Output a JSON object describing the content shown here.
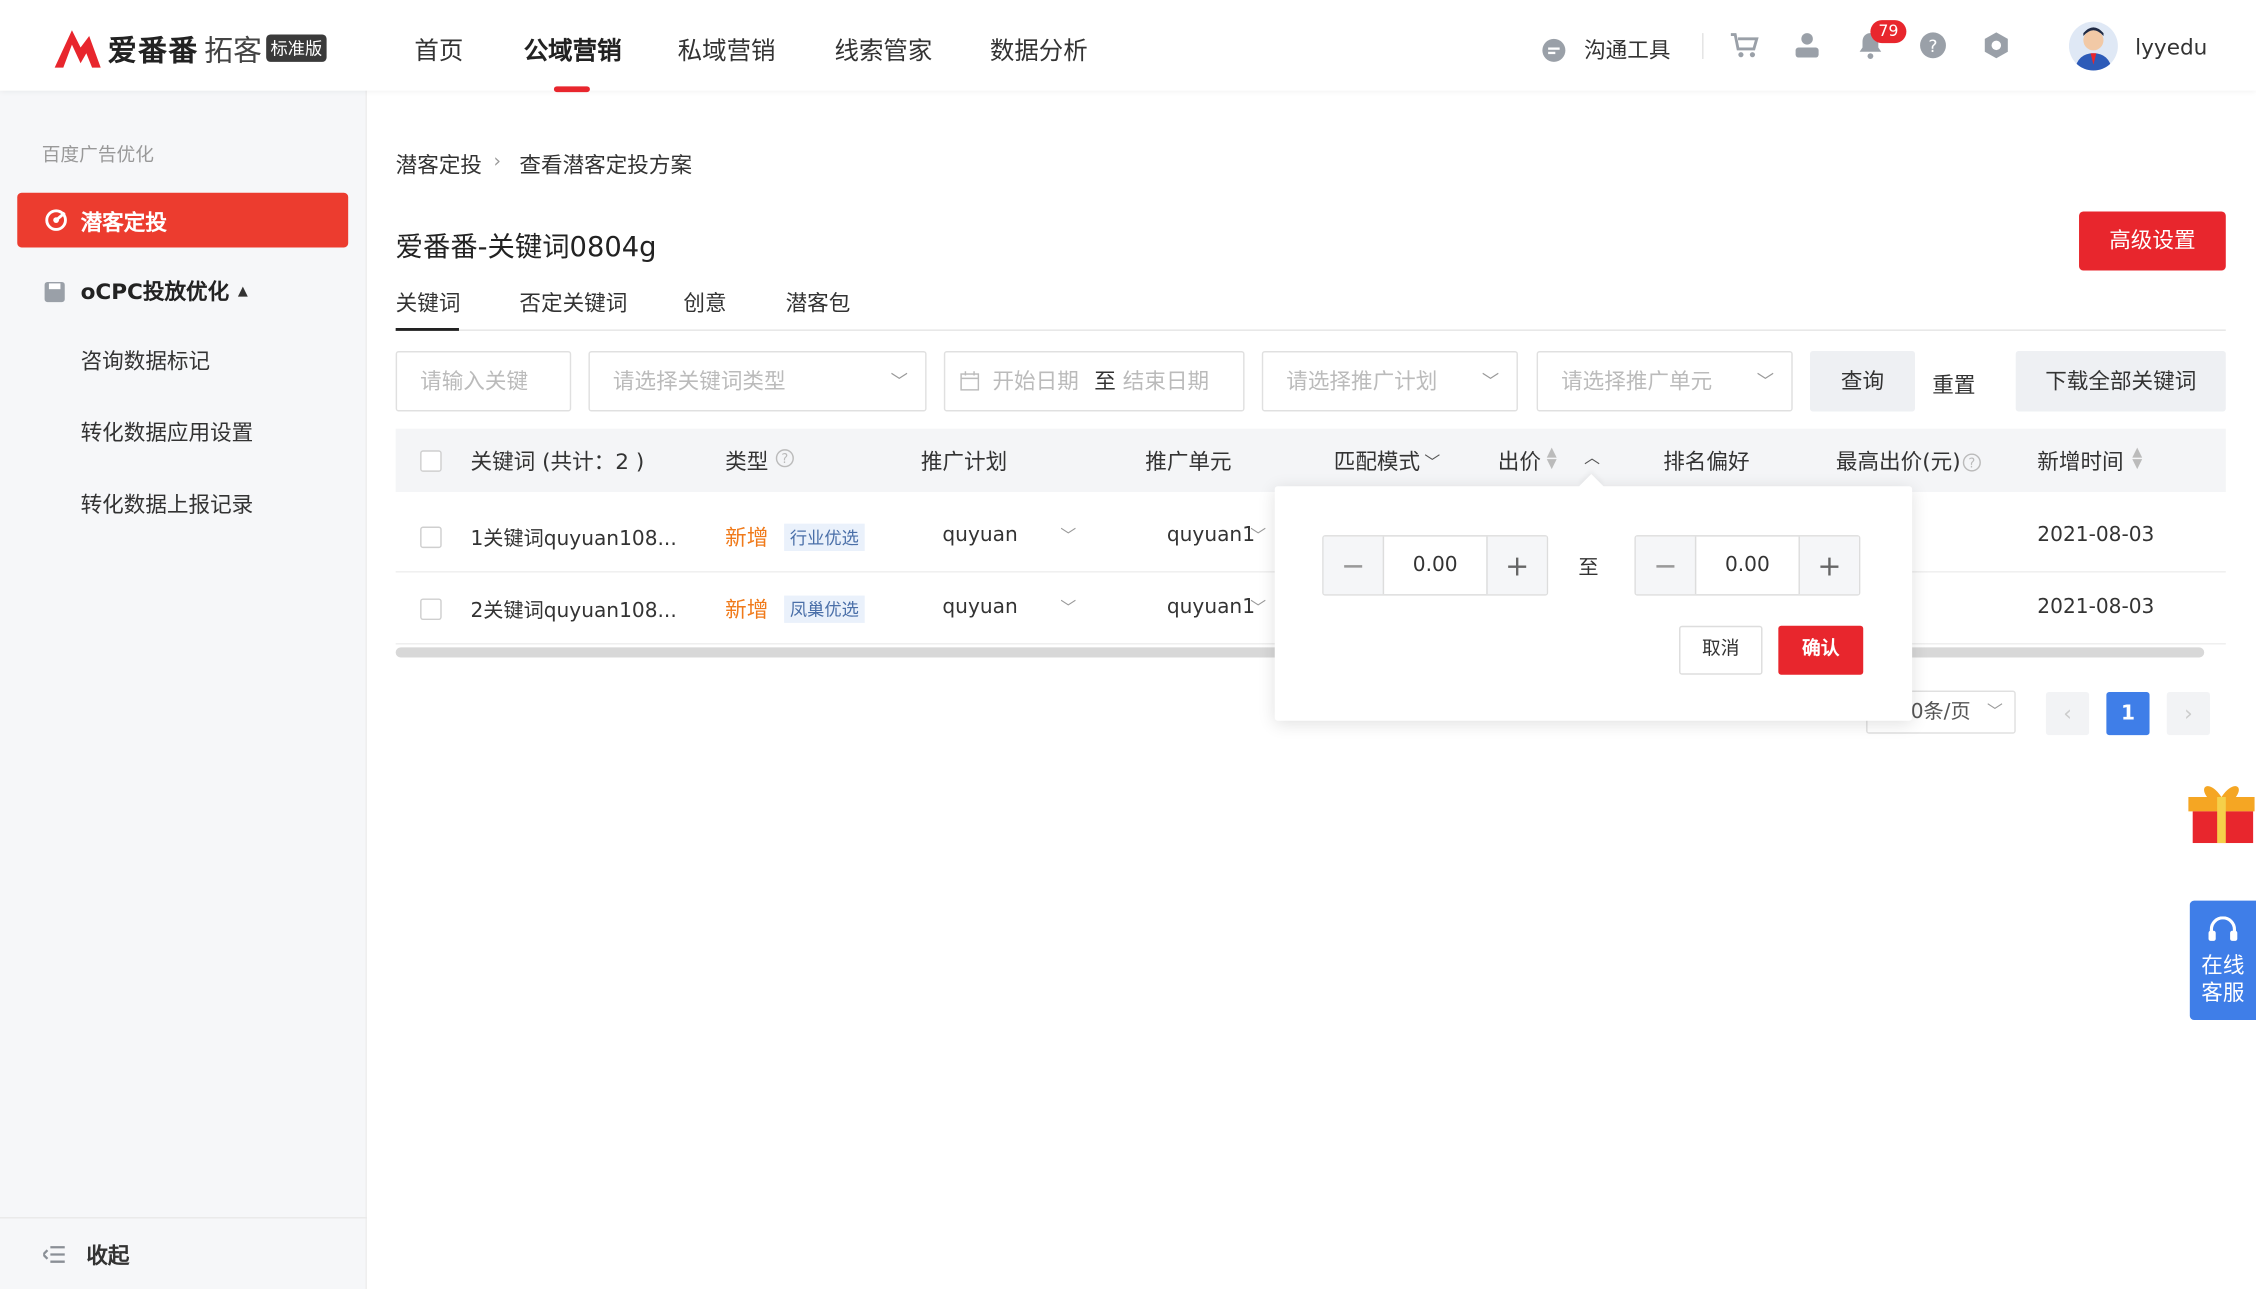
{
  "header": {
    "brand": "爱番番",
    "product": "拓客",
    "edition": "标准版",
    "nav": [
      "首页",
      "公域营销",
      "私域营销",
      "线索管家",
      "数据分析"
    ],
    "active_nav": "公域营销",
    "comm_tool": "沟通工具",
    "notification_count": "79",
    "username": "lyyedu",
    "icons": [
      "chat-icon",
      "cart-icon",
      "user-card-icon",
      "bell-icon",
      "help-icon",
      "settings-icon"
    ]
  },
  "sidebar": {
    "group": "百度广告优化",
    "active_item": "潜客定投",
    "section": "oCPC投放优化",
    "items": [
      "咨询数据标记",
      "转化数据应用设置",
      "转化数据上报记录"
    ],
    "collapse": "收起"
  },
  "breadcrumb": [
    "潜客定投",
    "查看潜客定投方案"
  ],
  "page": {
    "title": "爱番番-关键词0804g",
    "advanced_button": "高级设置",
    "tabs": [
      "关键词",
      "否定关键词",
      "创意",
      "潜客包"
    ],
    "active_tab": "关键词"
  },
  "filters": {
    "keyword_placeholder": "请输入关键",
    "type_placeholder": "请选择关键词类型",
    "start_date": "开始日期",
    "date_sep": "至",
    "end_date": "结束日期",
    "plan_placeholder": "请选择推广计划",
    "unit_placeholder": "请选择推广单元",
    "query": "查询",
    "reset": "重置",
    "download": "下载全部关键词"
  },
  "table": {
    "headers": [
      "关键词 (共计：2 )",
      "类型",
      "推广计划",
      "推广单元",
      "匹配模式",
      "出价",
      "排名偏好",
      "最高出价(元)",
      "新增时间"
    ],
    "rows": [
      {
        "keyword": "1关键词quyuan108...",
        "status": "新增",
        "tag": "行业优选",
        "plan": "quyuan",
        "unit": "quyuan1",
        "date": "2021-08-03"
      },
      {
        "keyword": "2关键词quyuan108...",
        "status": "新增",
        "tag": "凤巢优选",
        "plan": "quyuan",
        "unit": "quyuan1",
        "date": "2021-08-03"
      }
    ]
  },
  "bid_filter_popover": {
    "min": "0.00",
    "separator": "至",
    "max": "0.00",
    "cancel": "取消",
    "confirm": "确认"
  },
  "pagination": {
    "page_size": "0条/页",
    "current_page": "1"
  },
  "floating": {
    "service_line1": "在线",
    "service_line2": "客服"
  },
  "colors": {
    "brand_red": "#e8262d",
    "orange": "#f07a1a",
    "blue": "#3f7ee8"
  }
}
